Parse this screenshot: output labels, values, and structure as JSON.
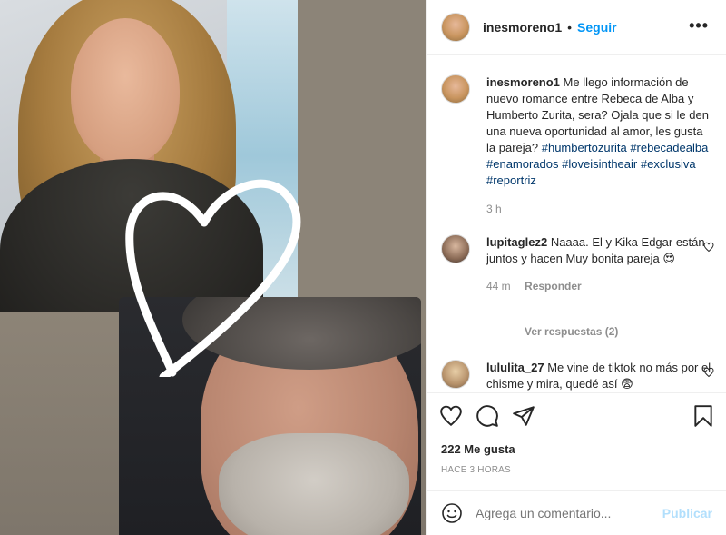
{
  "header": {
    "username": "inesmoreno1",
    "separator": "•",
    "follow_label": "Seguir",
    "more_icon": "more-horizontal-icon"
  },
  "caption": {
    "username": "inesmoreno1",
    "text": "Me llego información de nuevo romance entre Rebeca de Alba y Humberto Zurita, sera? Ojala que si le den una nueva oportunidad al amor, les gusta la pareja?",
    "hashtags": [
      "#humbertozurita",
      "#rebecadealba",
      "#enamorados",
      "#loveisintheair",
      "#exclusiva",
      "#reportriz"
    ],
    "time": "3 h"
  },
  "comments": [
    {
      "username": "lupitaglez2",
      "text": "Naaaa. El y Kika Edgar están juntos y hacen Muy bonita pareja",
      "emoji": "😍",
      "time": "44 m",
      "reply_label": "Responder",
      "view_replies": "Ver respuestas (2)"
    },
    {
      "username": "lululita_27",
      "text": "Me vine de tiktok no más por el chisme y mira, quedé así",
      "emoji": "😨"
    }
  ],
  "actions": {
    "icons": [
      "heart-icon",
      "comment-icon",
      "share-icon",
      "bookmark-icon"
    ]
  },
  "likes": "222 Me gusta",
  "posted_ago": "HACE 3 HORAS",
  "add_comment": {
    "placeholder": "Agrega un comentario...",
    "post_label": "Publicar",
    "emoji_icon": "smiley-icon"
  },
  "colors": {
    "link_blue": "#0095f6",
    "hashtag": "#00376b",
    "muted": "#8e8e8e",
    "publish_disabled": "#b2dffc"
  }
}
